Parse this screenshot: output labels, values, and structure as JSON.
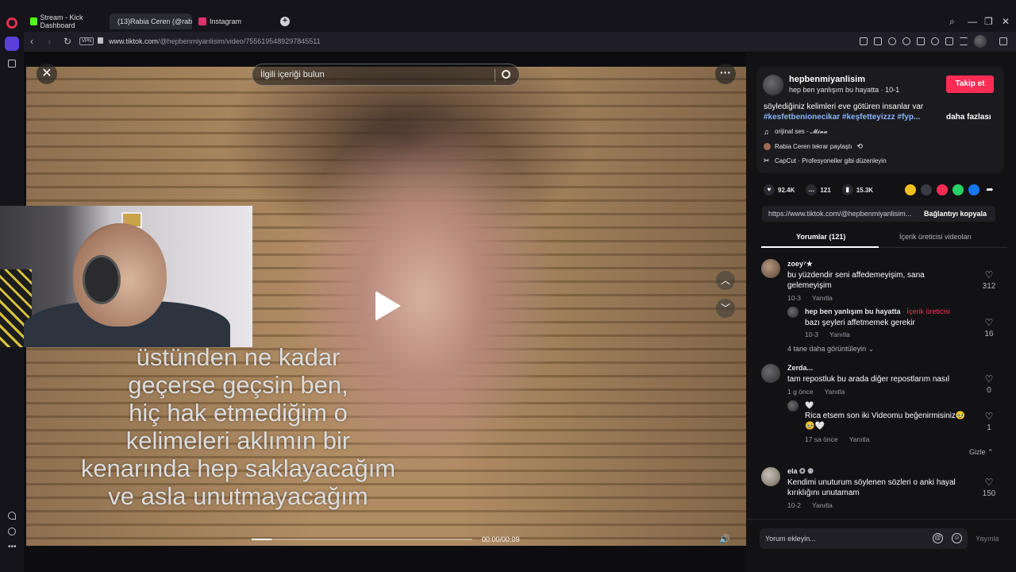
{
  "browser": {
    "tabs": [
      {
        "label": "Stream - Kick Dashboard",
        "color": "#53fc18"
      },
      {
        "label": "(13)Rabia Ceren (@rabia",
        "color": "#ffffff"
      },
      {
        "label": "Instagram",
        "color": "#e1306c"
      }
    ],
    "vpn": "VPN",
    "url_host": "www.tiktok.com",
    "url_path": "/@hepbenmiyanlisim/video/7556195489297845511"
  },
  "video": {
    "search_placeholder": "İlgili içeriği bulun",
    "caption_lines": [
      "üstünden ne kadar",
      "geçerse geçsin ben,",
      "hiç hak etmediğim o",
      "kelimeleri aklımın bir",
      "kenarında hep saklayacağım",
      "ve asla unutmayacağım"
    ],
    "time": "00:00/00:09",
    "progress": 0.09
  },
  "author": {
    "name": "hepbenmiyanlisim",
    "subtitle": "hep ben yanlışım bu hayatta · 10-1",
    "follow_label": "Takip et",
    "description": "söylediğiniz kelimleri eve götüren insanlar var",
    "hashtags": "#kesfetbenionecikar #keşfetteyizzz #fyp...",
    "more_label": "daha fazlası",
    "sound": "orijinal ses - 𝓜𝓲𝓷𝓪",
    "repost": "Rabia Ceren tekrar paylaştı",
    "capcut": "CapCut · Profesyoneller gibi düzenleyin"
  },
  "stats": {
    "likes": "92.4K",
    "comments": "121",
    "saves": "15.3K"
  },
  "link": {
    "url": "https://www.tiktok.com/@hepbenmiyanlisim...",
    "copy_label": "Bağlantıyı kopyala"
  },
  "tabs": {
    "comments": "Yorumlar (121)",
    "creator_videos": "İçerik üreticisi videoları"
  },
  "comments": [
    {
      "user": "zoey⁷★",
      "text1": "bu yüzdendir seni affedemeyişim, sana",
      "text2": "gelemeyişim",
      "date": "10-3",
      "reply_label": "Yanıtla",
      "likes": "312"
    },
    {
      "user": "hep ben yanlışım bu hayatta",
      "creator_label": " · İçerik üreticisi",
      "text1": "bazı şeyleri affetmemek gerekir",
      "date": "10-3",
      "reply_label": "Yanıtla",
      "likes": "16"
    },
    {
      "user": "Zerda...",
      "text1": "tam repostluk bu arada diğer repostlarım nasıl",
      "date": "1 g önce",
      "reply_label": "Yanıtla",
      "likes": "0"
    },
    {
      "user": "🤍",
      "text1": "Rica etsem son iki Videomu beğenirmisiniz🥹",
      "text2": "🥹🤍",
      "date": "17 sa önce",
      "reply_label": "Yanıtla",
      "likes": "1"
    },
    {
      "user": "ela",
      "text1": "Kendimi unuturum söylenen sözleri o anki hayal",
      "text2": "kırıklığını unutamam",
      "date": "10-2",
      "reply_label": "Yanıtla",
      "likes": "150"
    }
  ],
  "view_more": "4 tane daha görüntüleyin",
  "hide_label": "Gizle",
  "input": {
    "placeholder": "Yorum ekleyin...",
    "post_label": "Yayınla"
  }
}
